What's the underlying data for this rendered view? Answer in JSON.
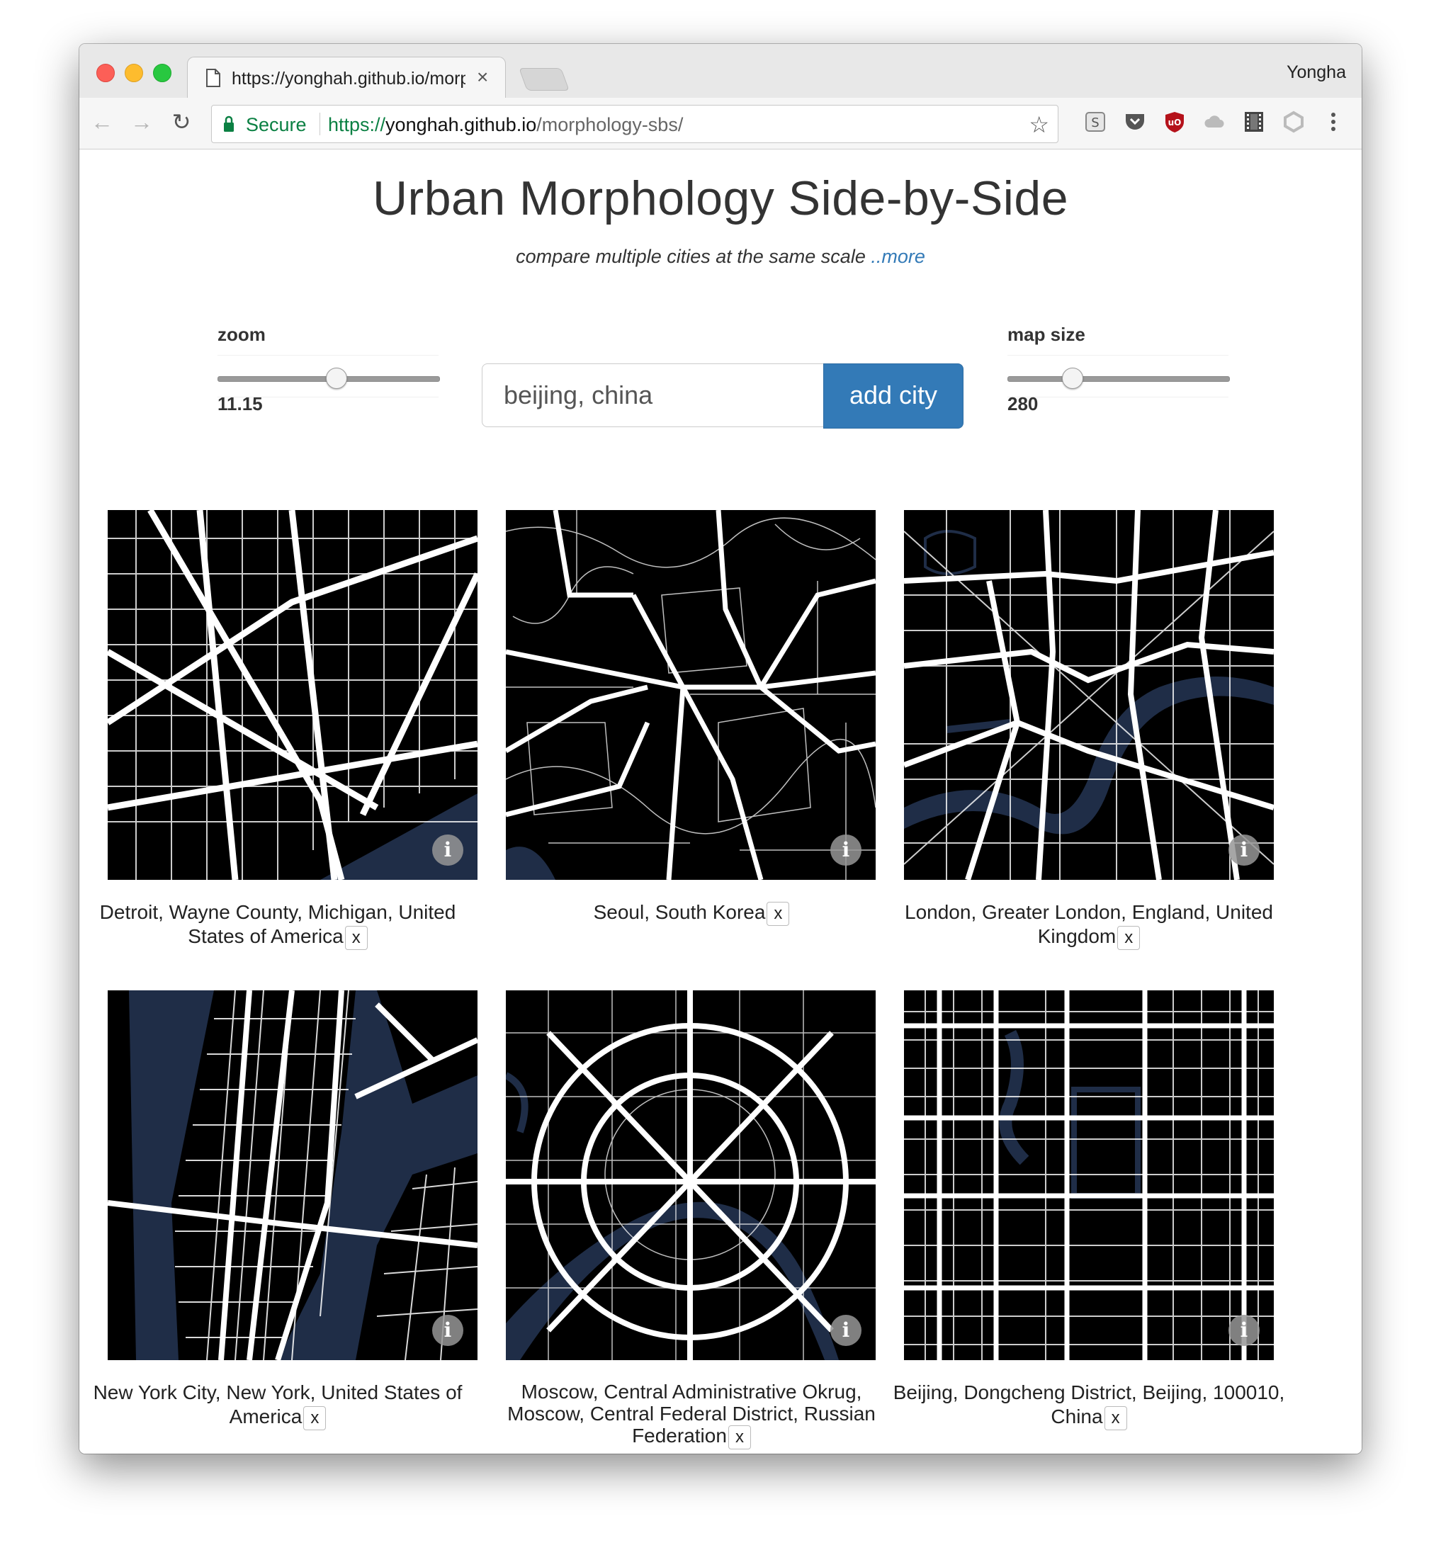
{
  "browser": {
    "tab_title": "https://yonghah.github.io/morp",
    "tab_close": "×",
    "profile_name": "Yongha",
    "secure_label": "Secure",
    "url_scheme": "https://",
    "url_host": "yonghah.github.io",
    "url_path": "/morphology-sbs/",
    "extensions": [
      "s-extension-icon",
      "pocket-icon",
      "ublock-icon",
      "cloud-icon",
      "film-icon",
      "hexagon-icon",
      "menu-dots-icon"
    ]
  },
  "page": {
    "title": "Urban Morphology Side-by-Side",
    "subtitle": "compare multiple cities at the same scale ",
    "more_link": "..more"
  },
  "controls": {
    "zoom": {
      "label": "zoom",
      "value": "11.15",
      "level_fraction": 0.54
    },
    "search": {
      "value": "beijing, china",
      "button_label": "add city"
    },
    "map_size": {
      "label": "map size",
      "value": "280",
      "level_fraction": 0.27
    }
  },
  "colors": {
    "water": "#1f2d47",
    "roads": "#ffffff",
    "land": "#000000",
    "button": "#337ab7"
  },
  "cities": [
    {
      "name": "Detroit, Wayne County, Michigan, United States of America",
      "remove": "x"
    },
    {
      "name": "Seoul, South Korea",
      "remove": "x"
    },
    {
      "name": "London, Greater London, England, United Kingdom",
      "remove": "x"
    },
    {
      "name": "New York City, New York, United States of America",
      "remove": "x"
    },
    {
      "name": "Moscow, Central Administrative Okrug, Moscow, Central Federal District, Russian Federation",
      "remove": "x"
    },
    {
      "name": "Beijing, Dongcheng District, Beijing, 100010, China",
      "remove": "x"
    }
  ]
}
